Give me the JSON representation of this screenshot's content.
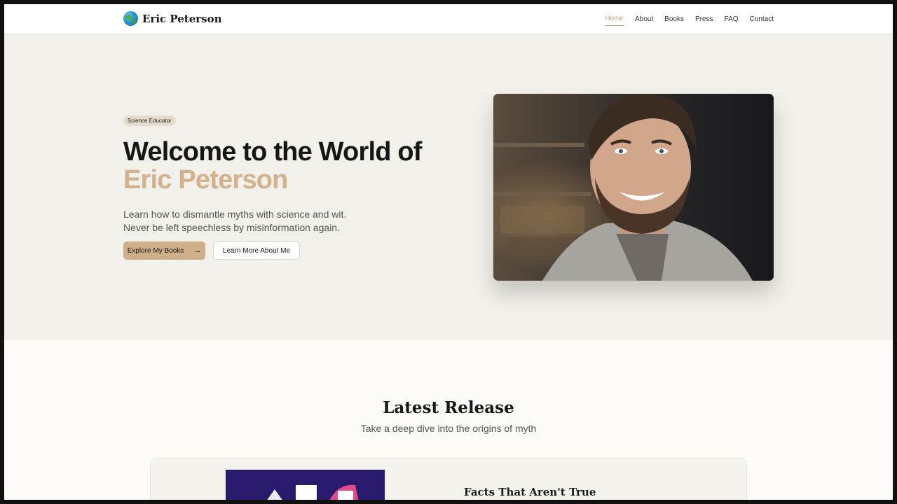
{
  "header": {
    "brand": "Eric Peterson",
    "nav": [
      {
        "label": "Home",
        "active": true
      },
      {
        "label": "About"
      },
      {
        "label": "Books"
      },
      {
        "label": "Press"
      },
      {
        "label": "FAQ"
      },
      {
        "label": "Contact"
      }
    ]
  },
  "hero": {
    "badge": "Science Educator",
    "title_line1": "Welcome to the World of",
    "title_line2": "Eric Peterson",
    "subtitle_line1": "Learn how to dismantle myths with science and wit.",
    "subtitle_line2": "Never be left speechless by misinformation again.",
    "primary_button": "Explore My Books",
    "secondary_button": "Learn More About Me"
  },
  "latest": {
    "title": "Latest Release",
    "subtitle": "Take a deep dive into the origins of myth",
    "book_title": "Facts That Aren't True"
  },
  "colors": {
    "accent": "#cfaf8a",
    "hero_bg": "#f1f0ea",
    "page_bg": "#fcfbf8"
  }
}
